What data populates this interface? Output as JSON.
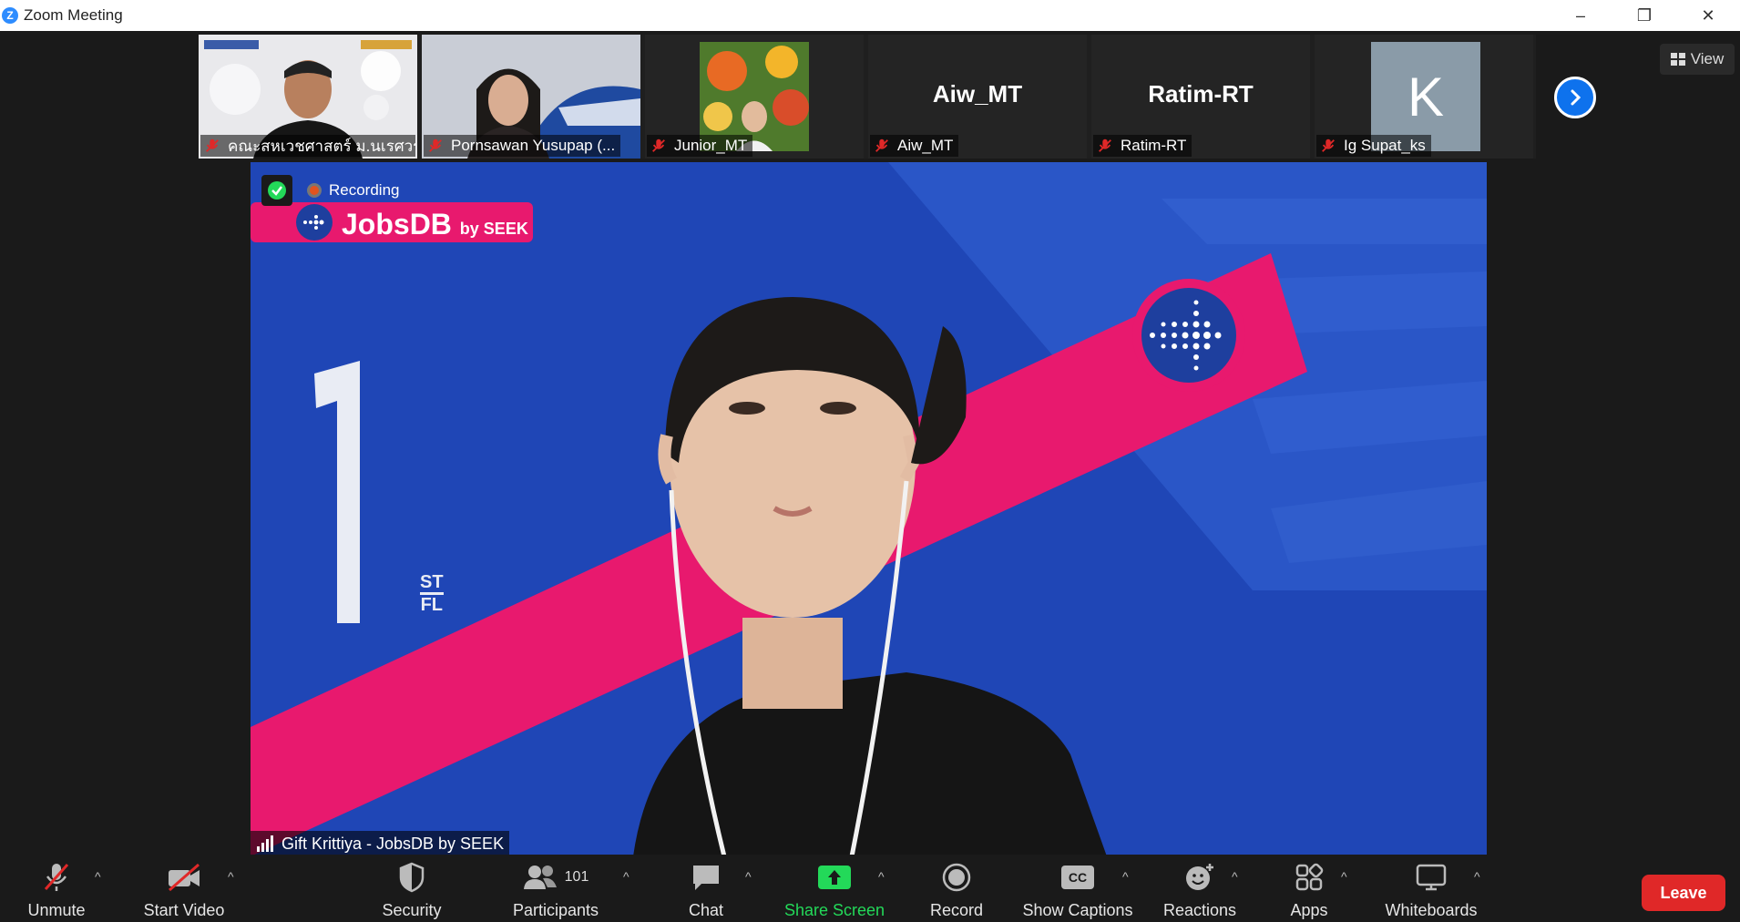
{
  "window": {
    "title": "Zoom Meeting",
    "logo_letter": "Z",
    "controls": [
      "–",
      "❐",
      "✕"
    ]
  },
  "participants_strip": [
    {
      "name": "คณะสหเวชศาสตร์ ม.นเรศวร",
      "type": "video",
      "muted": true
    },
    {
      "name": "Pornsawan Yusupap (...",
      "type": "video",
      "muted": true
    },
    {
      "name": "Junior_MT",
      "type": "photo",
      "muted": true
    },
    {
      "name": "Aiw_MT",
      "type": "text",
      "display": "Aiw_MT",
      "muted": true
    },
    {
      "name": "Ratim-RT",
      "type": "text",
      "display": "Ratim-RT",
      "muted": true
    },
    {
      "name": "Ig Supat_ks",
      "type": "avatar",
      "avatar_letter": "K",
      "muted": true
    }
  ],
  "view_button": {
    "label": "View"
  },
  "recording": {
    "label": "Recording"
  },
  "main_speaker": {
    "name": "Gift Krittiya - JobsDB by SEEK"
  },
  "banner": {
    "brand": "JobsDB",
    "suffix": "by SEEK",
    "floor": "1",
    "floor_sup": "ST",
    "floor_sub": "FL"
  },
  "toolbar": {
    "unmute": "Unmute",
    "start_video": "Start Video",
    "security": "Security",
    "participants": "Participants",
    "participants_count": "101",
    "chat": "Chat",
    "share_screen": "Share Screen",
    "record": "Record",
    "show_captions": "Show Captions",
    "captions_icon": "CC",
    "reactions": "Reactions",
    "apps": "Apps",
    "whiteboards": "Whiteboards",
    "leave": "Leave"
  },
  "colors": {
    "accent": "#0e72ed",
    "share_green": "#23d959",
    "leave_red": "#e02828",
    "brand_pink": "#e8196e",
    "background_blue": "#2147b8"
  }
}
